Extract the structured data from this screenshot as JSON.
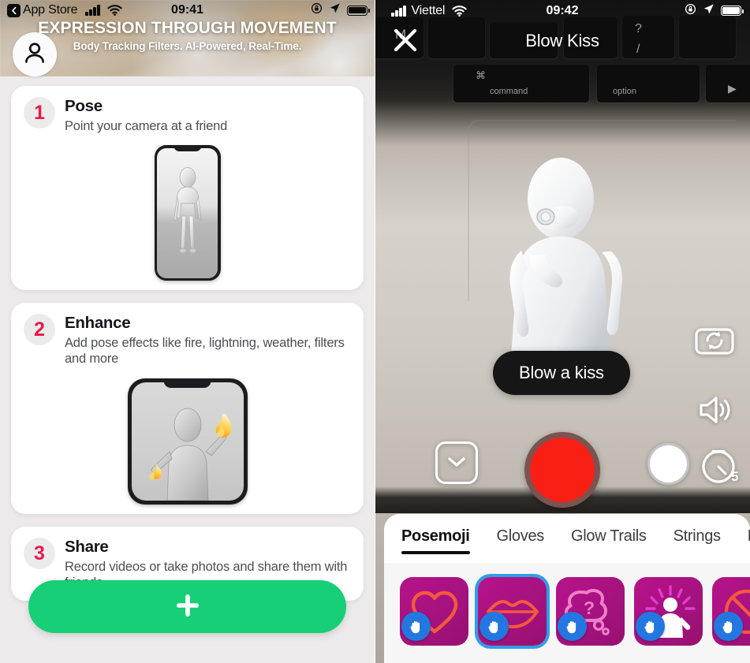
{
  "left": {
    "status_bar": {
      "back_label": "App Store",
      "back_icon": "chevron-left-icon",
      "signal_icon": "cellular-signal-icon",
      "wifi_icon": "wifi-icon",
      "time": "09:41",
      "rotation_lock_icon": "rotation-lock-icon",
      "location_icon": "location-arrow-icon",
      "battery_icon": "battery-full-icon"
    },
    "hero": {
      "title": "EXPRESSION THROUGH MOVEMENT",
      "subtitle": "Body Tracking Filters. AI-Powered, Real-Time.",
      "avatar_icon": "person-avatar-icon"
    },
    "cards": [
      {
        "number": "1",
        "title": "Pose",
        "description": "Point your camera at a friend",
        "preview_icon": "phone-mannequin-preview"
      },
      {
        "number": "2",
        "title": "Enhance",
        "description": "Add pose effects like fire, lightning, weather, filters and more",
        "preview_icon": "phone-fire-effect-preview"
      },
      {
        "number": "3",
        "title": "Share",
        "description": "Record videos or take photos and share them with friends",
        "preview_icon": "phone-share-preview"
      }
    ],
    "cta": {
      "icon": "plus-icon",
      "label": "",
      "color": "#16cf76"
    }
  },
  "right": {
    "status_bar": {
      "signal_icon": "cellular-signal-icon",
      "carrier": "Viettel",
      "wifi_icon": "wifi-icon",
      "time": "09:42",
      "rotation_lock_icon": "rotation-lock-icon",
      "location_icon": "location-arrow-icon",
      "battery_icon": "battery-full-icon"
    },
    "nav": {
      "close_icon": "close-x-icon",
      "title": "Blow Kiss"
    },
    "viewfinder": {
      "prompt": "Blow a kiss",
      "subject_icon": "mannequin-blow-kiss-icon"
    },
    "side_controls": [
      {
        "name": "flip-camera",
        "icon": "camera-flip-icon"
      },
      {
        "name": "sound-toggle",
        "icon": "speaker-icon"
      }
    ],
    "bottom_controls": {
      "download_icon": "chevron-down-square-icon",
      "record_icon": "record-button",
      "record_color": "#fa1f15",
      "photo_icon": "shutter-circle-icon",
      "timer_icon": "timer-icon",
      "timer_value": "5"
    },
    "sheet": {
      "tabs": [
        {
          "label": "Posemoji",
          "active": true
        },
        {
          "label": "Gloves",
          "active": false
        },
        {
          "label": "Glow Trails",
          "active": false
        },
        {
          "label": "Strings",
          "active": false
        },
        {
          "label": "Fi",
          "active": false
        }
      ],
      "filters": [
        {
          "name": "heart-filter",
          "icon": "heart-outline-icon",
          "selected": false,
          "badge_icon": "hand-icon"
        },
        {
          "name": "lips-filter",
          "icon": "lips-icon",
          "selected": true,
          "badge_icon": "hand-icon"
        },
        {
          "name": "thought-bubble-filter",
          "icon": "thought-bubble-question-icon",
          "selected": false,
          "badge_icon": "hand-icon"
        },
        {
          "name": "shine-person-filter",
          "icon": "person-rays-icon",
          "selected": false,
          "badge_icon": "hand-icon"
        },
        {
          "name": "no-entry-filter",
          "icon": "circle-slash-icon",
          "selected": false,
          "badge_icon": "hand-icon"
        }
      ],
      "selection_color": "#2e9fe8"
    }
  }
}
